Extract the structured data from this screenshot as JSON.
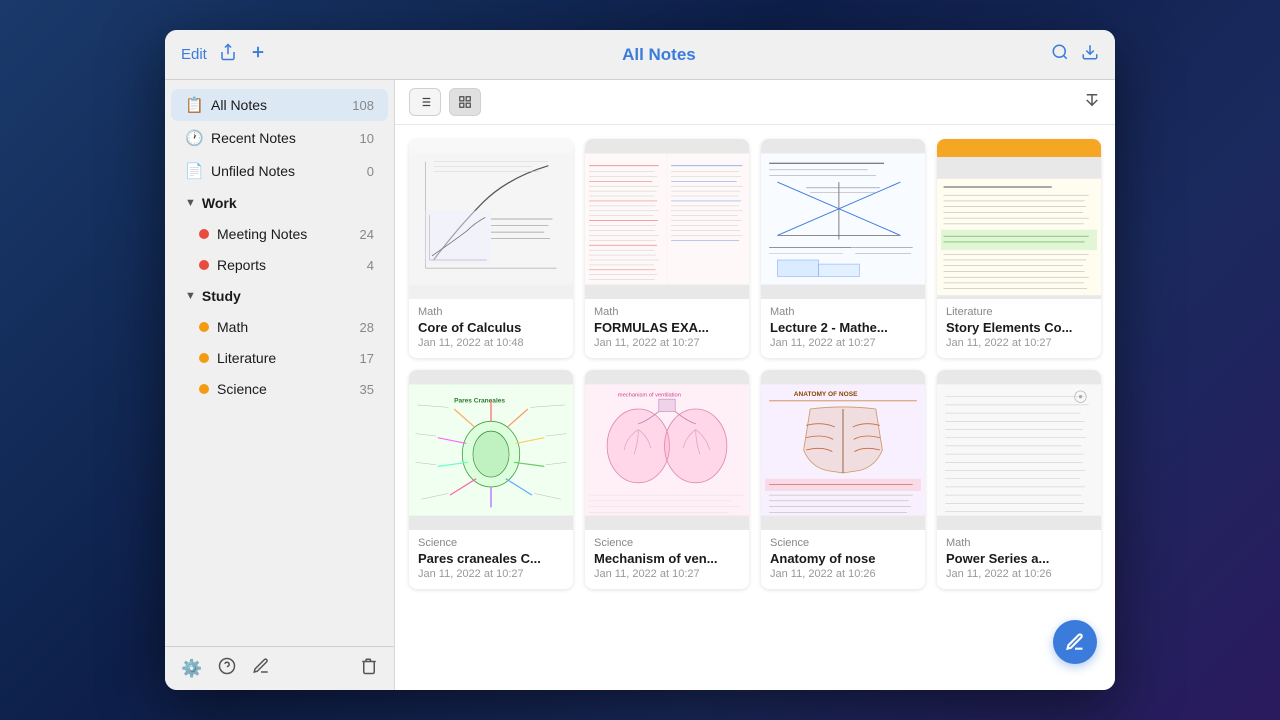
{
  "toolbar": {
    "edit_label": "Edit",
    "title": "All Notes",
    "share_icon": "share",
    "add_icon": "plus",
    "search_icon": "search",
    "export_icon": "export"
  },
  "sidebar": {
    "all_notes": {
      "label": "All Notes",
      "count": "108"
    },
    "recent_notes": {
      "label": "Recent Notes",
      "count": "10"
    },
    "unfiled_notes": {
      "label": "Unfiled Notes",
      "count": "0"
    },
    "work": {
      "label": "Work",
      "children": [
        {
          "label": "Meeting Notes",
          "count": "24",
          "color": "#e74c3c"
        },
        {
          "label": "Reports",
          "count": "4",
          "color": "#e74c3c"
        }
      ]
    },
    "study": {
      "label": "Study",
      "children": [
        {
          "label": "Math",
          "count": "28",
          "color": "#f39c12"
        },
        {
          "label": "Literature",
          "count": "17",
          "color": "#f39c12"
        },
        {
          "label": "Science",
          "count": "35",
          "color": "#f39c12"
        }
      ]
    }
  },
  "notes": [
    {
      "category": "Math",
      "title": "Core of Calculus",
      "date": "Jan 11, 2022 at 10:48",
      "thumb": "math1"
    },
    {
      "category": "Math",
      "title": "FORMULAS EXA...",
      "date": "Jan 11, 2022 at 10:27",
      "thumb": "math2"
    },
    {
      "category": "Math",
      "title": "Lecture 2 - Mathe...",
      "date": "Jan 11, 2022 at 10:27",
      "thumb": "math3"
    },
    {
      "category": "Literature",
      "title": "Story Elements Co...",
      "date": "Jan 11, 2022 at 10:27",
      "thumb": "lit"
    },
    {
      "category": "Science",
      "title": "Pares craneales C...",
      "date": "Jan 11, 2022 at 10:27",
      "thumb": "sci1"
    },
    {
      "category": "Science",
      "title": "Mechanism of ven...",
      "date": "Jan 11, 2022 at 10:27",
      "thumb": "sci2"
    },
    {
      "category": "Science",
      "title": "Anatomy of nose",
      "date": "Jan 11, 2022 at 10:26",
      "thumb": "sci3"
    },
    {
      "category": "Math",
      "title": "Power Series a...",
      "date": "Jan 11, 2022 at 10:26",
      "thumb": "math4"
    }
  ],
  "footer_icons": {
    "settings": "⚙",
    "help": "?",
    "pen": "✏",
    "trash": "🗑"
  },
  "fab": {
    "label": "✏"
  }
}
